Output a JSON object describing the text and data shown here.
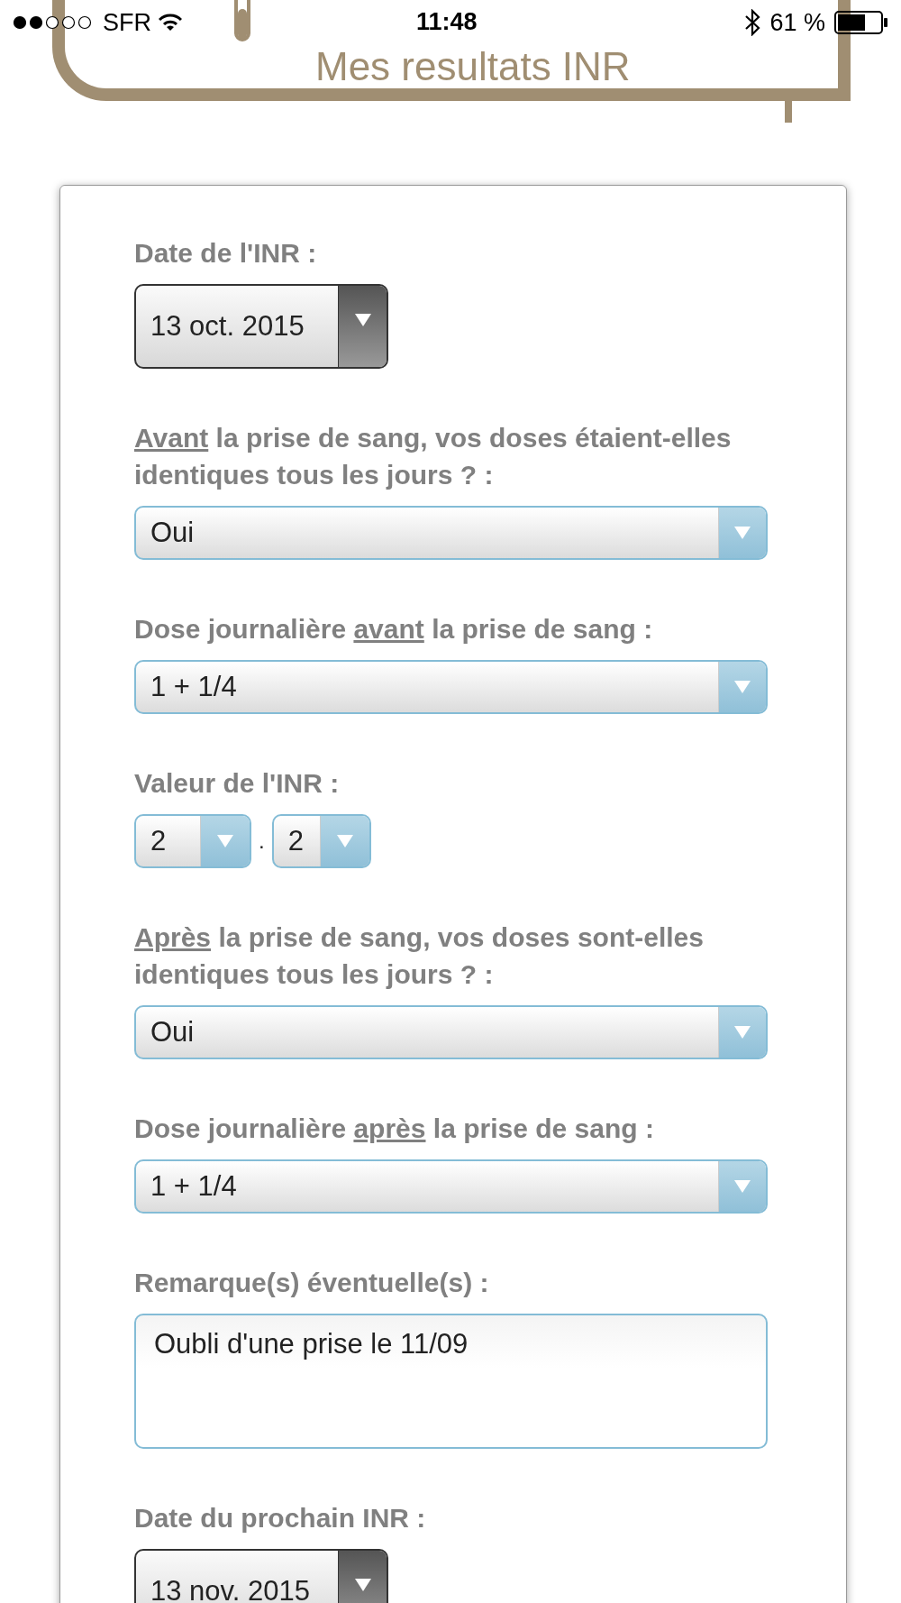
{
  "status_bar": {
    "carrier": "SFR",
    "time": "11:48",
    "battery": "61 %"
  },
  "header": {
    "title": "Mes resultats INR"
  },
  "fields": [
    {
      "kind": "date",
      "label": [
        {
          "text": "Date de l'INR :",
          "underlined": false
        }
      ],
      "value": "13 oct. 2015"
    },
    {
      "kind": "select",
      "label": [
        {
          "text": "Avant",
          "underlined": true
        },
        {
          "text": " la prise de sang, vos doses étaient-elles identiques tous les jours ? :",
          "underlined": false
        }
      ],
      "value": "Oui"
    },
    {
      "kind": "select",
      "label": [
        {
          "text": "Dose journalière ",
          "underlined": false
        },
        {
          "text": "avant",
          "underlined": true
        },
        {
          "text": " la prise de sang :",
          "underlined": false
        }
      ],
      "value": "1 + 1/4"
    },
    {
      "kind": "split",
      "label": [
        {
          "text": "Valeur de l'INR :",
          "underlined": false
        }
      ],
      "values": [
        "2",
        "2"
      ],
      "separator": "."
    },
    {
      "kind": "select",
      "label": [
        {
          "text": "Après",
          "underlined": true
        },
        {
          "text": " la prise de sang, vos doses sont-elles identiques tous les jours ? :",
          "underlined": false
        }
      ],
      "value": "Oui"
    },
    {
      "kind": "select",
      "label": [
        {
          "text": "Dose journalière ",
          "underlined": false
        },
        {
          "text": "après",
          "underlined": true
        },
        {
          "text": " la prise de sang :",
          "underlined": false
        }
      ],
      "value": "1 + 1/4"
    },
    {
      "kind": "textarea",
      "label": [
        {
          "text": "Remarque(s) éventuelle(s) :",
          "underlined": false
        }
      ],
      "value": "Oubli d'une prise le 11/09"
    },
    {
      "kind": "date",
      "label": [
        {
          "text": "Date du prochain INR :",
          "underlined": false
        }
      ],
      "value": "13 nov. 2015"
    }
  ]
}
